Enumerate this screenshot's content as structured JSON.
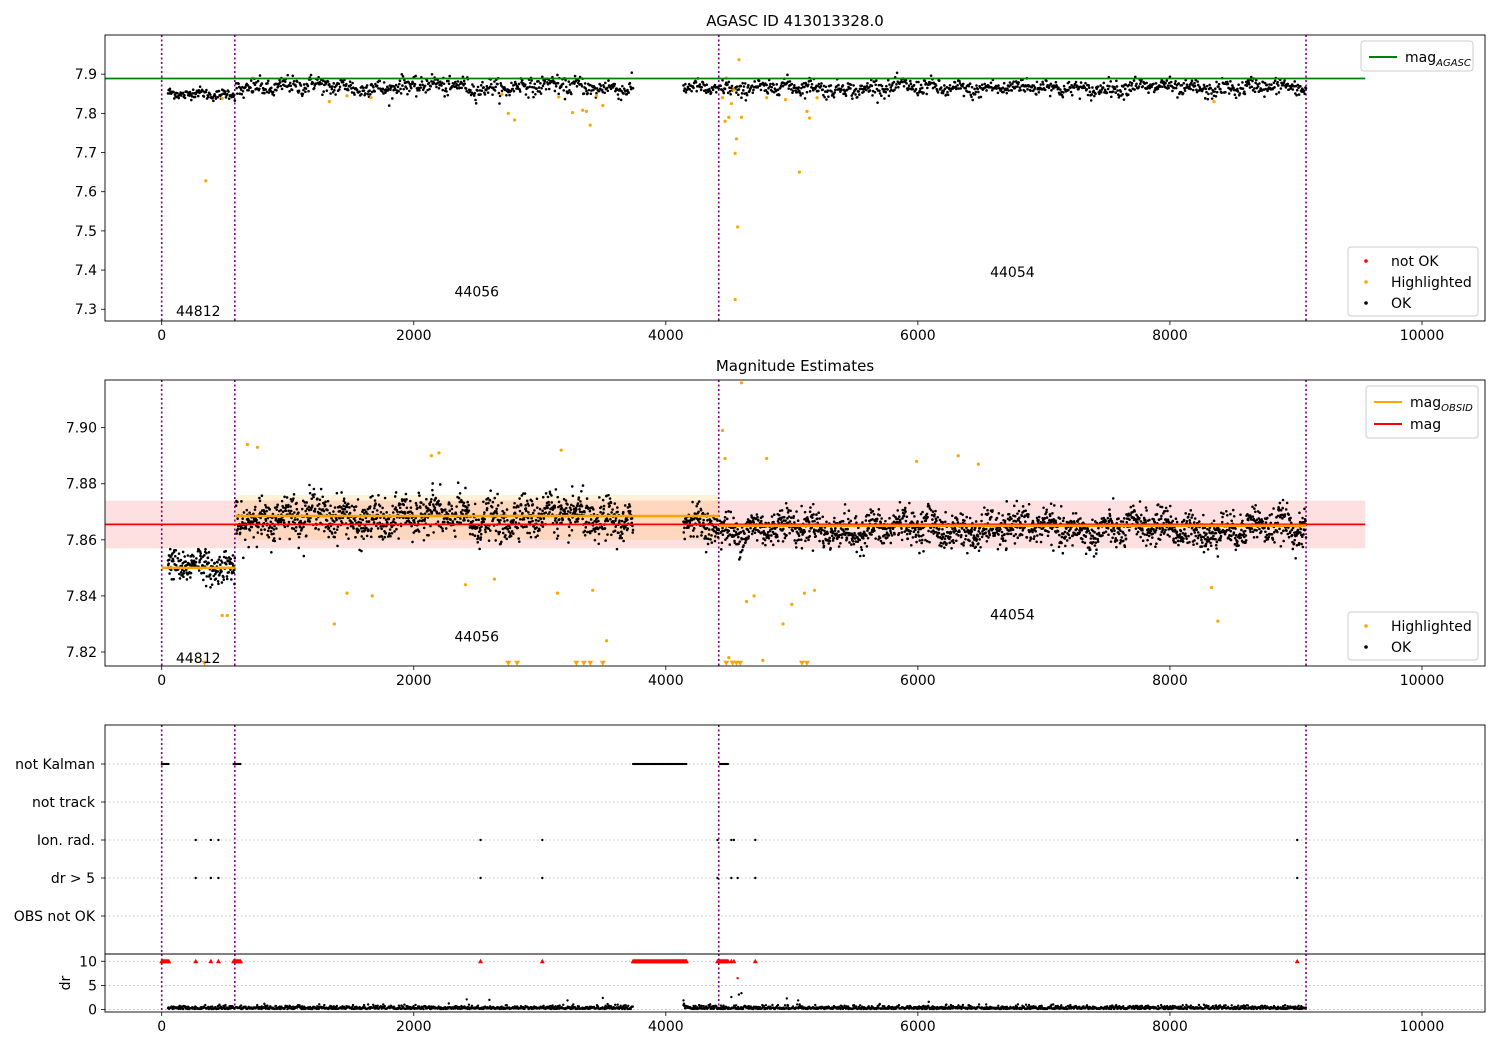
{
  "chart_data": [
    {
      "type": "scatter",
      "title": "AGASC ID 413013328.0",
      "xlim": [
        -450,
        10500
      ],
      "ylim": [
        7.27,
        8.0
      ],
      "xticks": [
        0,
        2000,
        4000,
        6000,
        8000,
        10000
      ],
      "yticks": [
        7.3,
        7.4,
        7.5,
        7.6,
        7.7,
        7.8,
        7.9
      ],
      "grid": false,
      "obsid_boundaries": [
        0,
        580,
        4420,
        9080
      ],
      "obsid_labels": [
        {
          "text": "44812",
          "x": 290,
          "y": 7.295
        },
        {
          "text": "44056",
          "x": 2500,
          "y": 7.345
        },
        {
          "text": "44054",
          "x": 6750,
          "y": 7.395
        }
      ],
      "segments": [
        {
          "x0": 50,
          "x1": 580,
          "mean": 7.848,
          "spread": 0.012
        },
        {
          "x0": 590,
          "x1": 3740,
          "mean": 7.868,
          "spread": 0.02
        },
        {
          "x0": 4140,
          "x1": 4420,
          "mean": 7.865,
          "spread": 0.016
        },
        {
          "x0": 4430,
          "x1": 9080,
          "mean": 7.865,
          "spread": 0.018
        }
      ],
      "lines": [
        {
          "name": "mag_AGASC",
          "color": "#008000",
          "x": [
            -450,
            9550
          ],
          "y": [
            7.889,
            7.889
          ]
        }
      ],
      "highlighted": [
        [
          350,
          7.628
        ],
        [
          480,
          7.838
        ],
        [
          720,
          7.89
        ],
        [
          1330,
          7.83
        ],
        [
          1470,
          7.845
        ],
        [
          1660,
          7.84
        ],
        [
          2700,
          7.849
        ],
        [
          2750,
          7.8
        ],
        [
          2800,
          7.783
        ],
        [
          3150,
          7.842
        ],
        [
          3260,
          7.802
        ],
        [
          3340,
          7.808
        ],
        [
          3370,
          7.805
        ],
        [
          3400,
          7.77
        ],
        [
          3450,
          7.845
        ],
        [
          3500,
          7.82
        ],
        [
          4450,
          7.84
        ],
        [
          4470,
          7.78
        ],
        [
          4500,
          7.79
        ],
        [
          4520,
          7.825
        ],
        [
          4540,
          7.86
        ],
        [
          4550,
          7.698
        ],
        [
          4560,
          7.735
        ],
        [
          4570,
          7.51
        ],
        [
          4550,
          7.325
        ],
        [
          4580,
          7.937
        ],
        [
          4600,
          7.79
        ],
        [
          4800,
          7.84
        ],
        [
          4950,
          7.835
        ],
        [
          5060,
          7.65
        ],
        [
          5120,
          7.805
        ],
        [
          5140,
          7.788
        ],
        [
          5200,
          7.84
        ],
        [
          8350,
          7.83
        ],
        [
          4480,
          7.89
        ]
      ],
      "legend": [
        {
          "label": "not OK",
          "color": "#ff0000"
        },
        {
          "label": "Highlighted",
          "color": "#ffa500"
        },
        {
          "label": "OK",
          "color": "#000000"
        }
      ],
      "line_legend": [
        {
          "label_main": "mag",
          "label_sub": "AGASC",
          "color": "#008000"
        }
      ]
    },
    {
      "type": "scatter",
      "title": "Magnitude Estimates",
      "xlim": [
        -450,
        10500
      ],
      "ylim": [
        7.815,
        7.917
      ],
      "xticks": [
        0,
        2000,
        4000,
        6000,
        8000,
        10000
      ],
      "yticks": [
        7.82,
        7.84,
        7.86,
        7.88,
        7.9
      ],
      "grid": false,
      "obsid_boundaries": [
        0,
        580,
        4420,
        9080
      ],
      "obsid_labels": [
        {
          "text": "44812",
          "x": 290,
          "y": 7.8178
        },
        {
          "text": "44056",
          "x": 2500,
          "y": 7.8255
        },
        {
          "text": "44054",
          "x": 6750,
          "y": 7.8333
        }
      ],
      "segments": [
        {
          "x0": 50,
          "x1": 580,
          "mean": 7.85,
          "spread": 0.005
        },
        {
          "x0": 590,
          "x1": 3740,
          "mean": 7.868,
          "spread": 0.0065
        },
        {
          "x0": 4140,
          "x1": 4420,
          "mean": 7.866,
          "spread": 0.005
        },
        {
          "x0": 4430,
          "x1": 9080,
          "mean": 7.864,
          "spread": 0.0055
        }
      ],
      "mag": {
        "value": 7.8655,
        "band_low": 7.857,
        "band_high": 7.874,
        "x0": -450,
        "x1": 9550,
        "color": "#ff0000"
      },
      "mag_obsid": [
        {
          "x0": 0,
          "x1": 580,
          "value": 7.85
        },
        {
          "x0": 580,
          "x1": 4420,
          "value": 7.8685
        },
        {
          "x0": 4420,
          "x1": 9080,
          "value": 7.865
        }
      ],
      "mag_obsid_band": {
        "low": 7.86,
        "high": 7.876
      },
      "highlighted": [
        [
          340,
          7.816
        ],
        [
          480,
          7.833
        ],
        [
          520,
          7.833
        ],
        [
          680,
          7.894
        ],
        [
          760,
          7.893
        ],
        [
          1370,
          7.83
        ],
        [
          1470,
          7.841
        ],
        [
          1670,
          7.84
        ],
        [
          2140,
          7.89
        ],
        [
          2200,
          7.891
        ],
        [
          2410,
          7.844
        ],
        [
          2640,
          7.846
        ],
        [
          2750,
          7.816
        ],
        [
          2820,
          7.816
        ],
        [
          3140,
          7.841
        ],
        [
          3170,
          7.892
        ],
        [
          3290,
          7.816
        ],
        [
          3350,
          7.816
        ],
        [
          3400,
          7.816
        ],
        [
          3420,
          7.842
        ],
        [
          3500,
          7.816
        ],
        [
          3530,
          7.824
        ],
        [
          4450,
          7.899
        ],
        [
          4470,
          7.889
        ],
        [
          4480,
          7.816
        ],
        [
          4500,
          7.818
        ],
        [
          4530,
          7.816
        ],
        [
          4560,
          7.816
        ],
        [
          4590,
          7.816
        ],
        [
          4600,
          7.916
        ],
        [
          4640,
          7.838
        ],
        [
          4700,
          7.84
        ],
        [
          4770,
          7.817
        ],
        [
          4800,
          7.889
        ],
        [
          4930,
          7.83
        ],
        [
          5000,
          7.837
        ],
        [
          5080,
          7.816
        ],
        [
          5100,
          7.841
        ],
        [
          5120,
          7.816
        ],
        [
          5180,
          7.842
        ],
        [
          5990,
          7.888
        ],
        [
          6320,
          7.89
        ],
        [
          6480,
          7.887
        ],
        [
          8330,
          7.843
        ],
        [
          8380,
          7.831
        ]
      ],
      "legend": [
        {
          "label": "Highlighted",
          "color": "#ffa500"
        },
        {
          "label": "OK",
          "color": "#000000"
        }
      ],
      "line_legend": [
        {
          "label_main": "mag",
          "label_sub": "OBSID",
          "color": "#ffa500"
        },
        {
          "label_main": "mag",
          "label_sub": "",
          "color": "#ff0000"
        }
      ]
    },
    {
      "type": "scatter",
      "title": "",
      "xlim": [
        -450,
        10500
      ],
      "categories": [
        "not Kalman",
        "not track",
        "Ion. rad.",
        "dr > 5",
        "OBS not OK"
      ],
      "grid": true,
      "obsid_boundaries": [
        0,
        580,
        4420,
        9080
      ],
      "flags": {
        "not Kalman": [
          [
            0,
            60
          ],
          [
            570,
            630
          ],
          [
            3740,
            4170
          ],
          [
            4430,
            4500
          ]
        ],
        "not track": [],
        "Ion. rad.": [
          270,
          390,
          450,
          2530,
          3020,
          4410,
          4520,
          4540,
          4710,
          9010
        ],
        "dr > 5": [
          270,
          390,
          450,
          2530,
          3020,
          4410,
          4520,
          4570,
          4710,
          9010
        ],
        "OBS not OK": []
      }
    },
    {
      "type": "scatter",
      "title": "",
      "ylabel": "dr",
      "xlim": [
        -450,
        10500
      ],
      "ylim": [
        -0.5,
        11.5
      ],
      "yticks": [
        0,
        5,
        10
      ],
      "xticks": [
        0,
        2000,
        4000,
        6000,
        8000,
        10000
      ],
      "grid": true,
      "obsid_boundaries": [
        0,
        580,
        4420,
        9080
      ],
      "red_at_10": [
        [
          0,
          60
        ],
        [
          570,
          630
        ],
        [
          3740,
          4170
        ],
        [
          4430,
          4500
        ]
      ],
      "red_single": [
        270,
        390,
        450,
        2530,
        3020,
        4410,
        4520,
        4540,
        4710,
        9010
      ],
      "outliers": [
        [
          4570,
          6.5
        ],
        [
          4600,
          3.4
        ],
        [
          2420,
          2.1
        ],
        [
          2600,
          2.0
        ],
        [
          3500,
          2.4
        ],
        [
          4960,
          2.3
        ],
        [
          5050,
          1.9
        ],
        [
          4140,
          1.9
        ],
        [
          3220,
          1.9
        ],
        [
          4520,
          2.6
        ],
        [
          4580,
          3.1
        ]
      ],
      "segments": [
        [
          50,
          580
        ],
        [
          590,
          3740
        ],
        [
          4140,
          4420
        ],
        [
          4430,
          9080
        ]
      ]
    }
  ]
}
